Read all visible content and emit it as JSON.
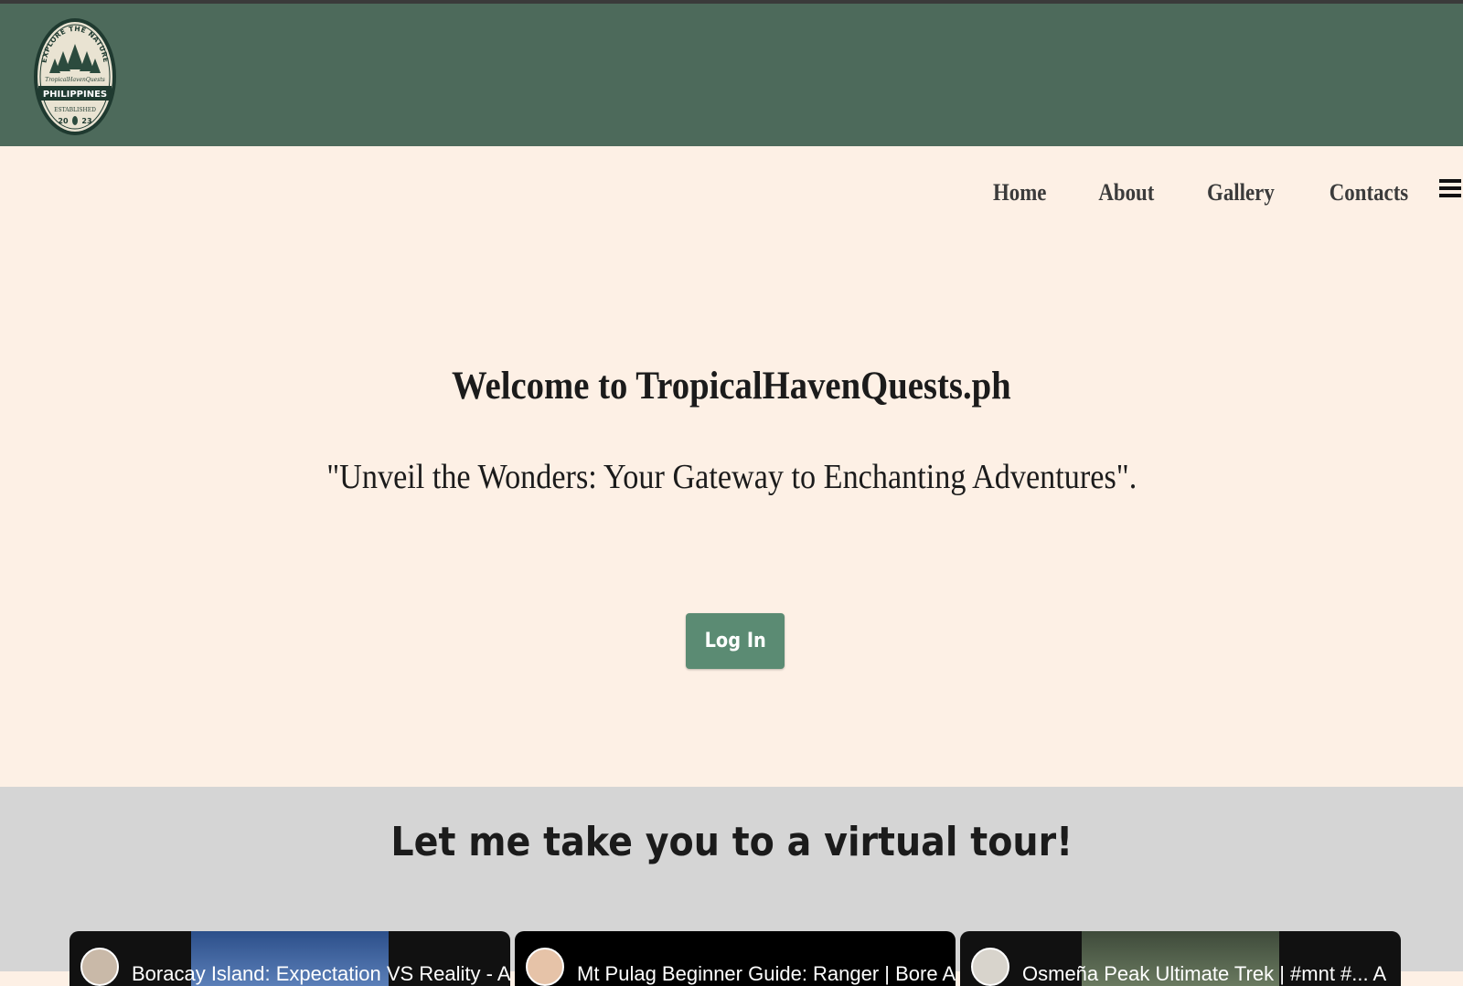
{
  "logo": {
    "arc_text": "EXPLORE THE NATURE",
    "script_text": "TropicalHavenQuests",
    "banner_text": "PHILIPPINES",
    "established_label": "ESTABLISHED",
    "year_left": "20",
    "year_right": "23"
  },
  "nav": {
    "items": [
      {
        "label": "Home"
      },
      {
        "label": "About"
      },
      {
        "label": "Gallery"
      },
      {
        "label": "Contacts"
      }
    ],
    "menu_icon": "hamburger-menu-icon"
  },
  "hero": {
    "title": "Welcome to TropicalHavenQuests.ph",
    "tagline": "\"Unveil the Wonders: Your Gateway to Enchanting Adventures\".",
    "login_label": "Log In"
  },
  "tour": {
    "title": "Let me take you to a virtual tour!",
    "videos": [
      {
        "title": "Boracay Island: Expectation VS Reality - A"
      },
      {
        "title": "Mt Pulag Beginner Guide: Ranger | Bore A"
      },
      {
        "title": "Osmeña Peak Ultimate Trek | #mnt #... A"
      }
    ]
  },
  "colors": {
    "header_bg": "#4d6a5b",
    "hero_bg": "#fdf0e5",
    "button_bg": "#5b8b73",
    "tour_bg": "#d5d5d5"
  }
}
